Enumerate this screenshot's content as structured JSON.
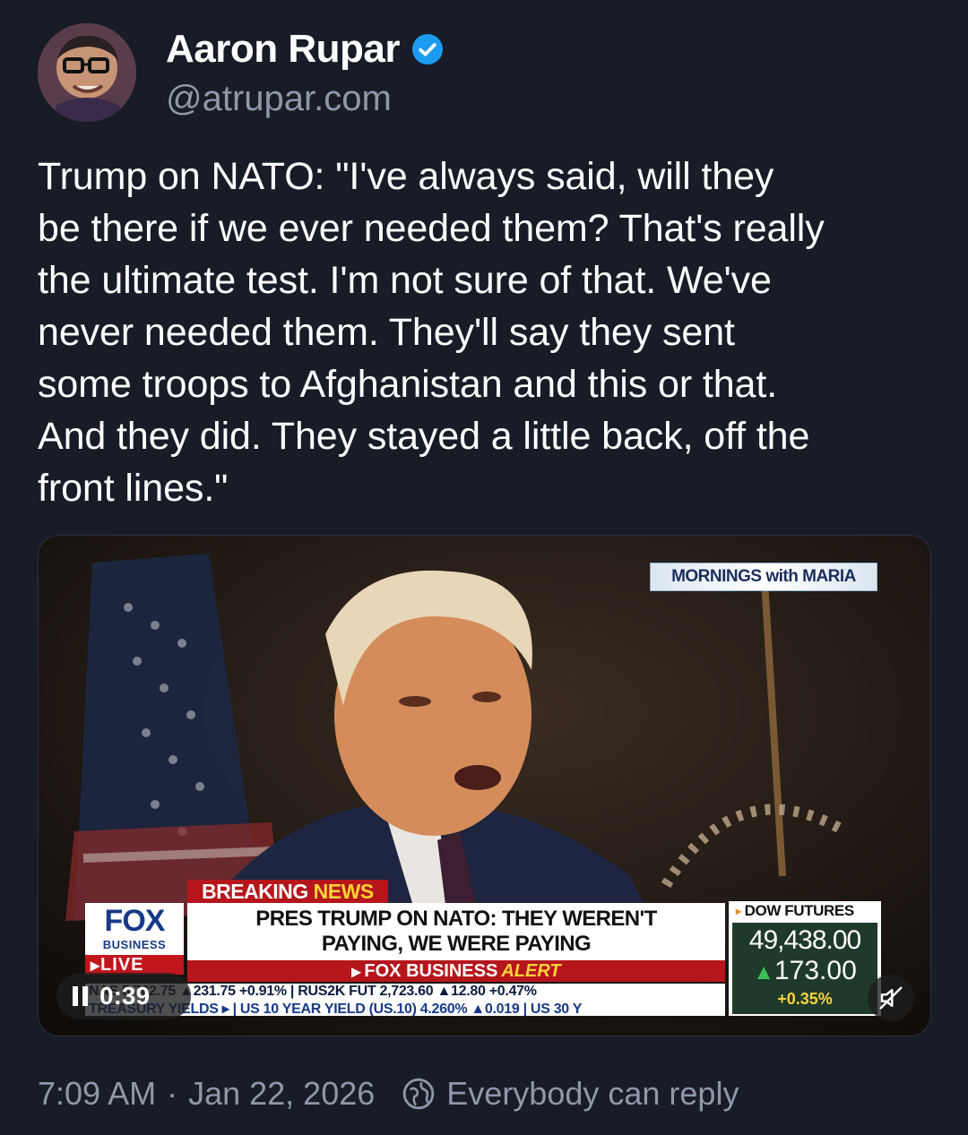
{
  "author": {
    "name": "Aaron Rupar",
    "handle": "@atrupar.com",
    "verified": true
  },
  "post": {
    "text": "Trump on NATO: \"I've always said, will they\nbe there if we ever needed them? That's really\nthe ultimate test. I'm not sure of that. We've\nnever needed them. They'll say they sent\nsome troops to Afghanistan and this or that.\nAnd they did. They stayed a little back, off the\nfront lines.\""
  },
  "video": {
    "show_logo": "MORNINGS with MARIA",
    "breaking_label": "BREAKING",
    "breaking_highlight": "NEWS",
    "network_logo": "FOX",
    "network_sub": "BUSINESS",
    "live_label": "LIVE",
    "headline_line1": "PRES TRUMP ON NATO: THEY WEREN'T",
    "headline_line2": "PAYING, WE WERE PAYING",
    "alert_brand": "FOX BUSINESS",
    "alert_word": "ALERT",
    "ticker_line1": "NAS  5,702.75 ▲231.75 +0.91% | RUS2K FUT  2,723.60 ▲12.80 +0.47%",
    "ticker_line2": "TREASURY YIELDS ▸ | US 10 YEAR YIELD (US.10) 4.260% ▲0.019 | US 30 Y",
    "dow_title": "DOW FUTURES",
    "dow_value": "49,438.00",
    "dow_change": "173.00",
    "dow_pct": "+0.35%",
    "elapsed_time": "0:39"
  },
  "meta": {
    "time": "7:09 AM",
    "separator": "·",
    "date": "Jan 22, 2026",
    "reply_setting": "Everybody can reply"
  },
  "colors": {
    "background": "#171c26",
    "verified_blue": "#1d9bf0",
    "muted_text": "#8e98a6",
    "fox_red": "#b5161b",
    "fox_blue": "#173a87"
  }
}
